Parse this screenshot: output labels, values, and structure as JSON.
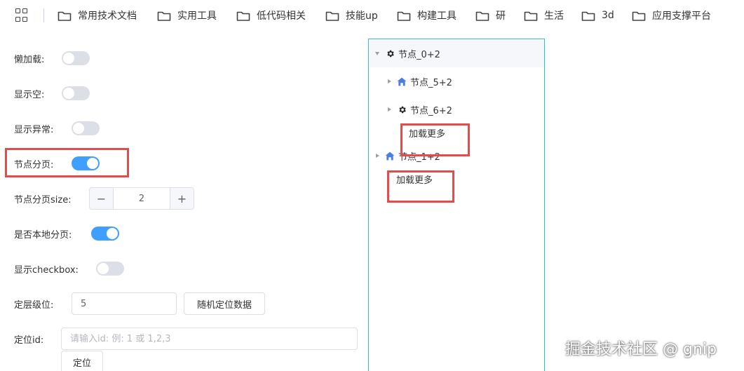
{
  "bookmarks": [
    {
      "label": "常用技术文档",
      "icon": "folder-icon"
    },
    {
      "label": "实用工具",
      "icon": "folder-icon"
    },
    {
      "label": "低代码相关",
      "icon": "folder-icon"
    },
    {
      "label": "技能up",
      "icon": "folder-icon"
    },
    {
      "label": "构建工具",
      "icon": "folder-icon"
    },
    {
      "label": "研",
      "icon": "folder-icon"
    },
    {
      "label": "生活",
      "icon": "folder-icon"
    },
    {
      "label": "3d",
      "icon": "folder-icon"
    },
    {
      "label": "应用支撑平台",
      "icon": "folder-icon"
    }
  ],
  "form": {
    "lazy_label": "懒加载:",
    "lazy_on": false,
    "show_empty_label": "显示空:",
    "show_empty_on": false,
    "show_error_label": "显示异常:",
    "show_error_on": false,
    "node_paging_label": "节点分页:",
    "node_paging_on": true,
    "page_size_label": "节点分页size:",
    "page_size_value": "2",
    "local_paging_label": "是否本地分页:",
    "local_paging_on": true,
    "show_checkbox_label": "显示checkbox:",
    "show_checkbox_on": false,
    "level_label": "定层级位:",
    "level_value": "5",
    "random_locate_button": "随机定位数据",
    "locate_id_label": "定位id:",
    "locate_id_placeholder": "请输入id: 例: 1 或 1,2,3",
    "locate_button": "定位",
    "minus_symbol": "−",
    "plus_symbol": "+"
  },
  "tree": {
    "nodes": [
      {
        "label": "节点_0+2",
        "icon": "gear-icon",
        "expanded": true
      },
      {
        "label": "节点_5+2",
        "icon": "home-icon",
        "expanded": false
      },
      {
        "label": "节点_6+2",
        "icon": "gear-icon",
        "expanded": false
      },
      {
        "label": "节点_1+2",
        "icon": "home-icon",
        "expanded": false
      }
    ],
    "load_more_1": "加载更多",
    "load_more_2": "加载更多"
  },
  "watermark": "掘金技术社区 @ gnip",
  "colors": {
    "switch_on": "#409eff",
    "switch_off": "#dcdfe6",
    "highlight_box": "#e64b4b",
    "panel_border": "#27c3cf",
    "home_icon": "#4a7ee0"
  }
}
